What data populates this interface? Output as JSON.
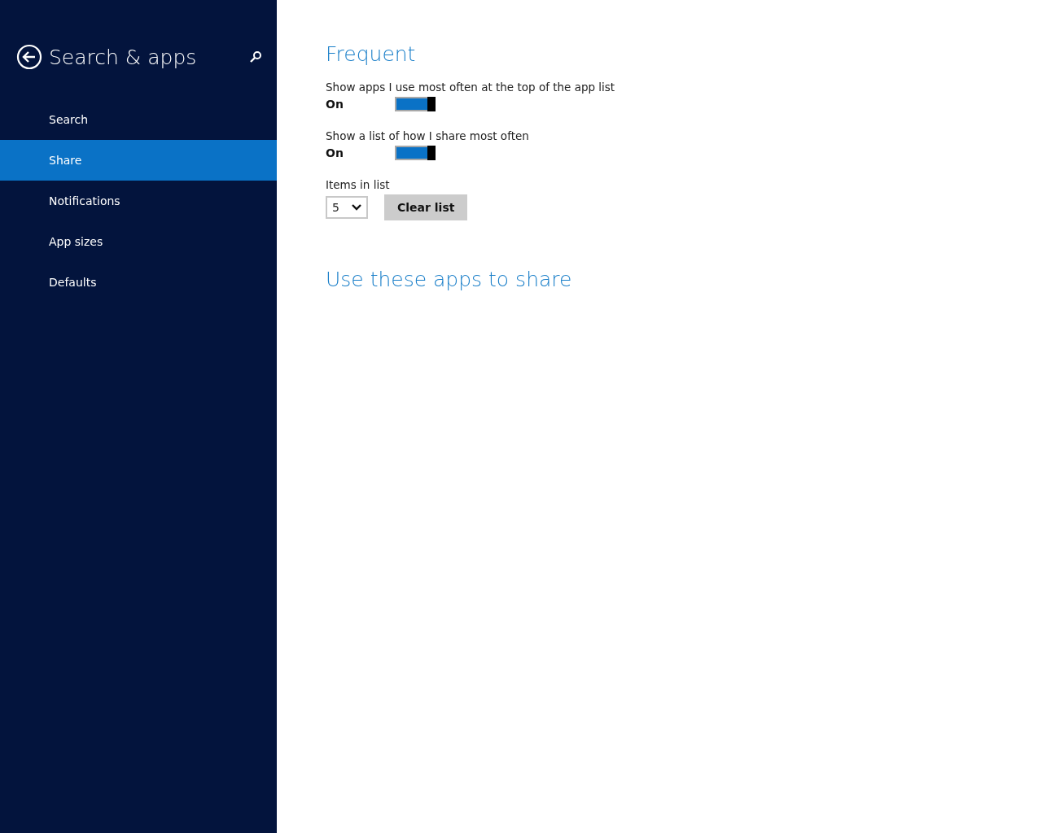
{
  "sidebar": {
    "title": "Search & apps",
    "items": [
      {
        "label": "Search",
        "selected": false
      },
      {
        "label": "Share",
        "selected": true
      },
      {
        "label": "Notifications",
        "selected": false
      },
      {
        "label": "App sizes",
        "selected": false
      },
      {
        "label": "Defaults",
        "selected": false
      }
    ]
  },
  "sections": [
    {
      "heading": "Frequent",
      "settings": [
        {
          "kind": "toggle",
          "label": "Show apps I use most often at the top of the app list",
          "state_text": "On",
          "on": true
        },
        {
          "kind": "toggle",
          "label": "Show a list of how I share most often",
          "state_text": "On",
          "on": true
        },
        {
          "kind": "select",
          "label": "Items in list",
          "value": "5",
          "button": "Clear list"
        }
      ]
    },
    {
      "heading": "Use these apps to share"
    }
  ]
}
